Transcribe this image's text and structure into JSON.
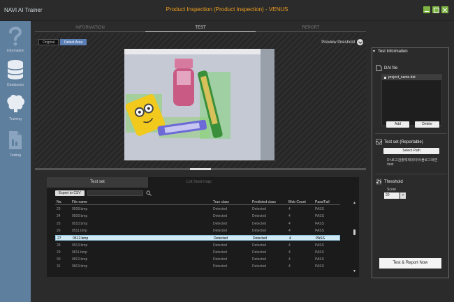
{
  "window": {
    "app_name": "NAVI AI Trainer",
    "title": "Product Inspection (Product Inspection) - VENUS"
  },
  "sidebar": {
    "items": [
      {
        "label": "Information",
        "icon": "question-mark-icon"
      },
      {
        "label": "Databases",
        "icon": "database-icon"
      },
      {
        "label": "Training",
        "icon": "brain-icon"
      },
      {
        "label": "Testing",
        "icon": "document-icon"
      }
    ]
  },
  "tabs": [
    "INFORMATION",
    "TEST",
    "REPORT"
  ],
  "active_tab": "TEST",
  "preview": {
    "toggle_original": "Original",
    "toggle_detect": "Detect Area",
    "preview_threshold": "Preview threshold"
  },
  "test_panel": {
    "tab_test_set": "Test set",
    "tab_heatmap": "List heat-map",
    "export_label": "Export to CSV",
    "columns": [
      "No.",
      "File name",
      "True class",
      "Predicted class",
      "Blob Count",
      "Pass/Fail"
    ],
    "rows": [
      [
        "23",
        "0508.bmp",
        "Detected",
        "Detected",
        "4",
        "PASS"
      ],
      [
        "24",
        "0509.bmp",
        "Detected",
        "Detected",
        "4",
        "PASS"
      ],
      [
        "25",
        "0510.bmp",
        "Detected",
        "Detected",
        "4",
        "PASS"
      ],
      [
        "26",
        "0511.bmp",
        "Detected",
        "Detected",
        "4",
        "PASS"
      ],
      [
        "27",
        "0512.bmp",
        "Detected",
        "Detected",
        "4",
        "PASS"
      ],
      [
        "28",
        "0513.bmp",
        "Detected",
        "Detected",
        "4",
        "PASS"
      ],
      [
        "29",
        "0811.bmp",
        "Detected",
        "Detected",
        "4",
        "PASS"
      ],
      [
        "30",
        "0812.bmp",
        "Detected",
        "Detected",
        "4",
        "PASS"
      ],
      [
        "31",
        "0813.bmp",
        "Detected",
        "Detected",
        "4",
        "PASS"
      ]
    ],
    "selected_index": 4
  },
  "right_panel": {
    "title": "Test Information",
    "dai_file_label": "DAI file",
    "dai_file_name": "project_name.dat",
    "add_label": "Add",
    "delete_label": "Delete",
    "test_set_label": "Test set (Reportable)",
    "select_path_label": "Select Path",
    "test_path": "D:\\로고검출예제데이터\\블로그화면\\test",
    "threshold_label": "Threshold",
    "score_label": "Score",
    "score_value": "20",
    "score_btn": ">",
    "run_label": "Test & Report Now"
  },
  "colors": {
    "accent_title": "#f0a020",
    "sidebar_bg": "#5f7f9f",
    "window_buttons": "#7cb342",
    "selected_row": "#cfe9f5"
  }
}
